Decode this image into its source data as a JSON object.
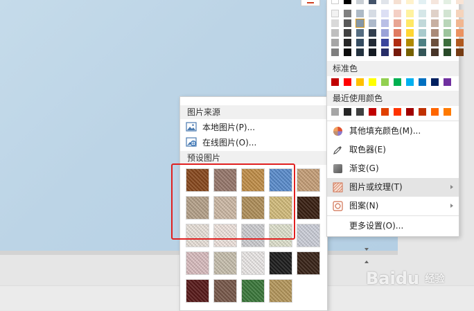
{
  "color_panel": {
    "theme_colors_rows": [
      [
        "#ffffff",
        "#000000",
        "#c8ced4",
        "#44546a",
        "#e0e4ea",
        "#f5e0d2",
        "#fff2cc",
        "#e2f0f3",
        "#f5e6dd",
        "#e3efe3",
        "#f8e4d6"
      ],
      [
        "#f2f2f2",
        "#7f7f7f",
        "#aebac6",
        "#d6dce4",
        "#dcdff4",
        "#f4cfc5",
        "#fff2a0",
        "#d5e7e8",
        "#dfd1c8",
        "#d2e4d2",
        "#f5d3bb"
      ],
      [
        "#d9d9d9",
        "#595959",
        "#8496a6",
        "#adb9ca",
        "#b9bfe6",
        "#e8a593",
        "#ffe866",
        "#c1d9da",
        "#c7b0a2",
        "#b9d6b9",
        "#f1b690"
      ],
      [
        "#bfbfbf",
        "#404040",
        "#546c80",
        "#323f4f",
        "#9aa2d8",
        "#e07a60",
        "#ffd633",
        "#a9cbcd",
        "#a98a78",
        "#9cc49c",
        "#eb9260"
      ],
      [
        "#a6a6a6",
        "#262626",
        "#344b60",
        "#222a35",
        "#3a449c",
        "#b02b10",
        "#b08a00",
        "#4e8184",
        "#6b4f3c",
        "#3c6e3c",
        "#b05a20"
      ],
      [
        "#7f7f7f",
        "#0d0d0d",
        "#23323f",
        "#161c23",
        "#272d68",
        "#75190a",
        "#756000",
        "#345658",
        "#473428",
        "#284928",
        "#753c14"
      ]
    ],
    "standard_title": "标准色",
    "standard_colors": [
      "#c00000",
      "#ff0000",
      "#ffc000",
      "#ffff00",
      "#92d050",
      "#00b050",
      "#00b0f0",
      "#0070c0",
      "#002060",
      "#7030a0"
    ],
    "recent_title": "最近使用颜色",
    "recent_colors": [
      "#a6a6a6",
      "#262626",
      "#404040",
      "#c00000",
      "#e04000",
      "#ff3300",
      "#a00000",
      "#c03000",
      "#ff6600",
      "#ff7a00"
    ],
    "menu": [
      {
        "label": "其他填充颜色(M)...",
        "icon": "color-wheel-icon",
        "has_sub": false
      },
      {
        "label": "取色器(E)",
        "icon": "eyedropper-icon",
        "has_sub": false
      },
      {
        "label": "渐变(G)",
        "icon": "gradient-icon",
        "has_sub": false
      },
      {
        "label": "图片或纹理(T)",
        "icon": "texture-icon",
        "has_sub": true,
        "active": true
      },
      {
        "label": "图案(N)",
        "icon": "pattern-icon",
        "has_sub": true
      },
      {
        "label": "更多设置(O)...",
        "icon": "",
        "has_sub": false
      }
    ]
  },
  "pic_panel": {
    "source_title": "图片来源",
    "local_label": "本地图片(P)...",
    "online_label": "在线图片(O)...",
    "preset_title": "预设图片"
  },
  "textures": [
    [
      "#8b4a1e",
      "#9a7a6e",
      "#c4914a",
      "#5c8fd0",
      "#c9a27a"
    ],
    [
      "#b8a48c",
      "#d0bca8",
      "#b3925c",
      "#d6bf7e",
      "#3a2012"
    ],
    [
      "#ece4dc",
      "#f2e6e0",
      "#d0d0d4",
      "#e2e4d0",
      "#cfd2dc"
    ],
    [
      "#dcc0c2",
      "#cac2b0",
      "#eeebea",
      "#1e1e1e",
      "#3a2418"
    ],
    [
      "#5a1a1a",
      "#7a5a4c",
      "#3c7a3c",
      "#b89a5e"
    ]
  ],
  "watermark": {
    "brand": "Bai",
    "paw": "du",
    "suffix": "经验"
  }
}
